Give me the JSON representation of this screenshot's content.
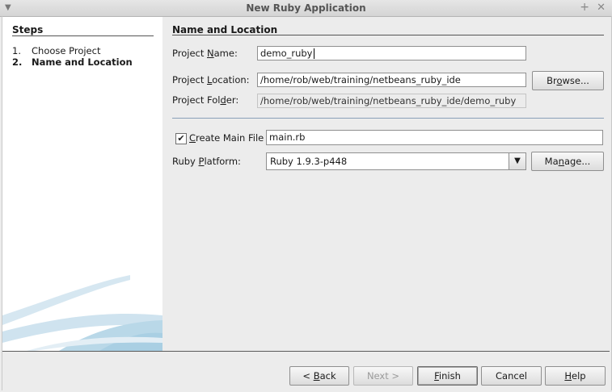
{
  "window": {
    "title": "New Ruby Application"
  },
  "steps": {
    "title": "Steps",
    "items": [
      {
        "num": "1.",
        "label": "Choose Project"
      },
      {
        "num": "2.",
        "label": "Name and Location"
      }
    ]
  },
  "main": {
    "title": "Name and Location",
    "project_name": {
      "label_pre": "Project ",
      "label_mn": "N",
      "label_post": "ame:",
      "value": "demo_ruby"
    },
    "project_location": {
      "label_pre": "Project ",
      "label_mn": "L",
      "label_post": "ocation:",
      "value": "/home/rob/web/training/netbeans_ruby_ide",
      "browse_pre": "Br",
      "browse_mn": "o",
      "browse_post": "wse..."
    },
    "project_folder": {
      "label_pre": "Project Fol",
      "label_mn": "d",
      "label_post": "er:",
      "value": "/home/rob/web/training/netbeans_ruby_ide/demo_ruby"
    },
    "create_main_file": {
      "checked": true,
      "check_glyph": "✔",
      "label_mn": "C",
      "label_post": "reate Main File",
      "value": "main.rb"
    },
    "ruby_platform": {
      "label_pre": "Ruby ",
      "label_mn": "P",
      "label_post": "latform:",
      "value": "Ruby 1.9.3-p448",
      "manage_pre": "Ma",
      "manage_mn": "n",
      "manage_post": "age..."
    }
  },
  "buttons": {
    "back": {
      "pre": "< ",
      "mn": "B",
      "post": "ack"
    },
    "next": {
      "label": "Next >"
    },
    "finish": {
      "mn": "F",
      "post": "inish"
    },
    "cancel": {
      "label": "Cancel"
    },
    "help": {
      "mn": "H",
      "post": "elp"
    }
  }
}
